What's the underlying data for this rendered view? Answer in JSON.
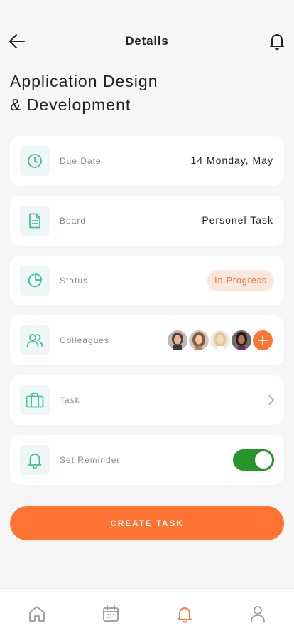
{
  "header": {
    "title": "Details"
  },
  "page": {
    "title_line1": "Application Design",
    "title_line2": "& Development"
  },
  "fields": {
    "due_date": {
      "label": "Due Date",
      "value": "14 Monday, May",
      "icon": "clock-icon"
    },
    "board": {
      "label": "Board",
      "value": "Personel Task",
      "icon": "document-icon"
    },
    "status": {
      "label": "Status",
      "value": "In Progress",
      "icon": "pie-chart-icon"
    },
    "colleagues": {
      "label": "Colleagues",
      "icon": "users-icon",
      "avatar_count": 4
    },
    "task": {
      "label": "Task",
      "icon": "briefcase-icon"
    },
    "reminder": {
      "label": "Set Reminder",
      "icon": "bell-icon",
      "enabled": true
    }
  },
  "actions": {
    "create_label": "CREATE TASK"
  },
  "bottom_nav": {
    "items": [
      "home-icon",
      "calendar-icon",
      "bell-icon",
      "user-icon"
    ],
    "active": "bell-icon"
  },
  "colors": {
    "accent": "#ff7433",
    "teal": "#3fbf9f",
    "toggle_on": "#27962a",
    "status_bg": "#fde7dd"
  }
}
